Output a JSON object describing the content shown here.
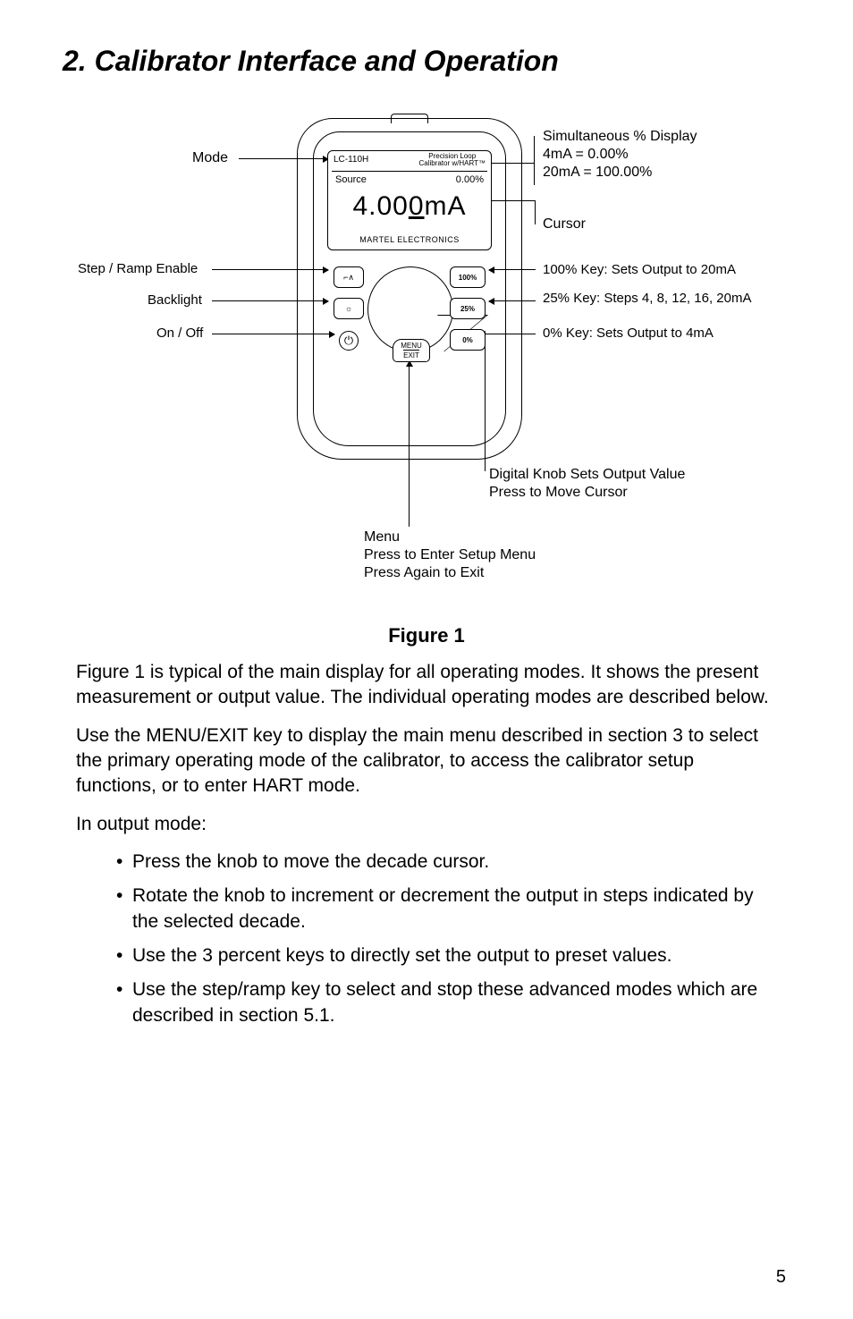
{
  "title": "2. Calibrator Interface and Operation",
  "figure": {
    "caption": "Figure 1",
    "device": {
      "model": "LC-110H",
      "subtitle_line1": "Precision Loop",
      "subtitle_line2": "Calibrator w/HART™",
      "mode_text": "Source",
      "percent_text": "0.00%",
      "main_pre": "4.00",
      "main_cursor": "0",
      "main_post": "mA",
      "brand": "MARTEL ELECTRONICS",
      "menu_line1": "MENU",
      "menu_line2": "EXIT",
      "key_100": "100%",
      "key_25": "25%",
      "key_0": "0%",
      "key_step_glyph": "⌐∧",
      "key_backlight_glyph": "☼",
      "key_power_glyph": "⏻"
    },
    "labels": {
      "mode": "Mode",
      "step_ramp": "Step / Ramp Enable",
      "backlight": "Backlight",
      "onoff": "On / Off",
      "sim1": "Simultaneous % Display",
      "sim2": "4mA = 0.00%",
      "sim3": "20mA = 100.00%",
      "cursor": "Cursor",
      "k100": "100% Key: Sets Output to 20mA",
      "k25": "25% Key: Steps 4, 8, 12, 16, 20mA",
      "k0": "0% Key: Sets Output to 4mA",
      "knob1": "Digital Knob Sets Output Value",
      "knob2": "Press to Move Cursor",
      "menu1": "Menu",
      "menu2": "Press to Enter Setup Menu",
      "menu3": "Press Again to Exit"
    }
  },
  "body": {
    "p1": "Figure 1 is typical of the main display for all operating modes.  It shows the present measurement or output value.  The individual operating modes are described below.",
    "p2": "Use the MENU/EXIT key to display the main menu described in section 3 to select the primary operating mode of the calibrator, to access the calibrator setup functions, or to enter HART mode.",
    "p3": "In output mode:",
    "bullets": [
      "Press the knob to move the decade cursor.",
      "Rotate the knob to increment or decrement the output in steps indicated by the selected decade.",
      "Use the 3 percent keys to directly set the output to preset values.",
      "Use the step/ramp key to select and stop these advanced modes which are described in section 5.1."
    ]
  },
  "page_number": "5"
}
